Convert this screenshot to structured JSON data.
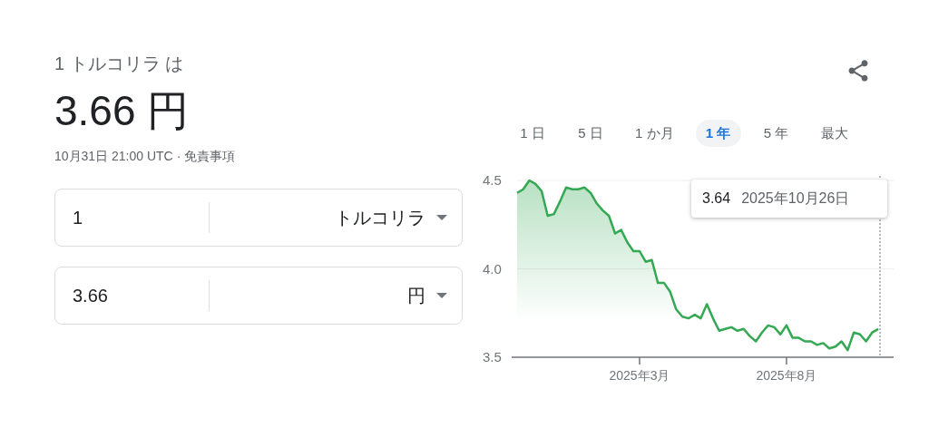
{
  "summary": {
    "label": "1 トルコリラ は",
    "value": "3.66 円",
    "timestamp": "10月31日 21:00 UTC",
    "separator": "·",
    "disclaimer": "免責事項"
  },
  "converter": [
    {
      "amount": "1",
      "currency": "トルコリラ"
    },
    {
      "amount": "3.66",
      "currency": "円"
    }
  ],
  "range_tabs": [
    {
      "label": "1 日",
      "selected": false
    },
    {
      "label": "5 日",
      "selected": false
    },
    {
      "label": "1 か月",
      "selected": false
    },
    {
      "label": "1 年",
      "selected": true
    },
    {
      "label": "5 年",
      "selected": false
    },
    {
      "label": "最大",
      "selected": false
    }
  ],
  "chart": {
    "tooltip": {
      "value": "3.64",
      "date": "2025年10月26日"
    },
    "chart_data": {
      "type": "area",
      "ylim": [
        3.5,
        4.5
      ],
      "yticks": [
        {
          "value": 3.5,
          "label": "3.5"
        },
        {
          "value": 4,
          "label": "4.0"
        },
        {
          "value": 4.5,
          "label": "4.5"
        }
      ],
      "categories": [
        null,
        null,
        null,
        null,
        null,
        null,
        null,
        null,
        null,
        null,
        null,
        null,
        null,
        null,
        null,
        null,
        null,
        null,
        null,
        null,
        "2025年3月",
        null,
        null,
        null,
        null,
        null,
        null,
        null,
        null,
        null,
        null,
        null,
        null,
        null,
        null,
        null,
        null,
        null,
        null,
        null,
        null,
        null,
        null,
        null,
        "2025年8月",
        null,
        null,
        null,
        null,
        null,
        null,
        null,
        null,
        null,
        null,
        null,
        null,
        null,
        null,
        null
      ],
      "series": [
        {
          "color": "#34a853",
          "values": [
            4.43,
            4.45,
            4.5,
            4.48,
            4.44,
            4.3,
            4.31,
            4.38,
            4.46,
            4.45,
            4.45,
            4.46,
            4.43,
            4.37,
            4.33,
            4.3,
            4.2,
            4.22,
            4.15,
            4.1,
            4.1,
            4.04,
            4.05,
            3.92,
            3.92,
            3.87,
            3.77,
            3.73,
            3.72,
            3.74,
            3.72,
            3.8,
            3.72,
            3.65,
            3.66,
            3.67,
            3.65,
            3.66,
            3.62,
            3.59,
            3.64,
            3.68,
            3.67,
            3.63,
            3.68,
            3.61,
            3.61,
            3.59,
            3.59,
            3.57,
            3.58,
            3.55,
            3.56,
            3.59,
            3.54,
            3.64,
            3.63,
            3.59,
            3.64,
            3.66
          ]
        }
      ]
    }
  }
}
